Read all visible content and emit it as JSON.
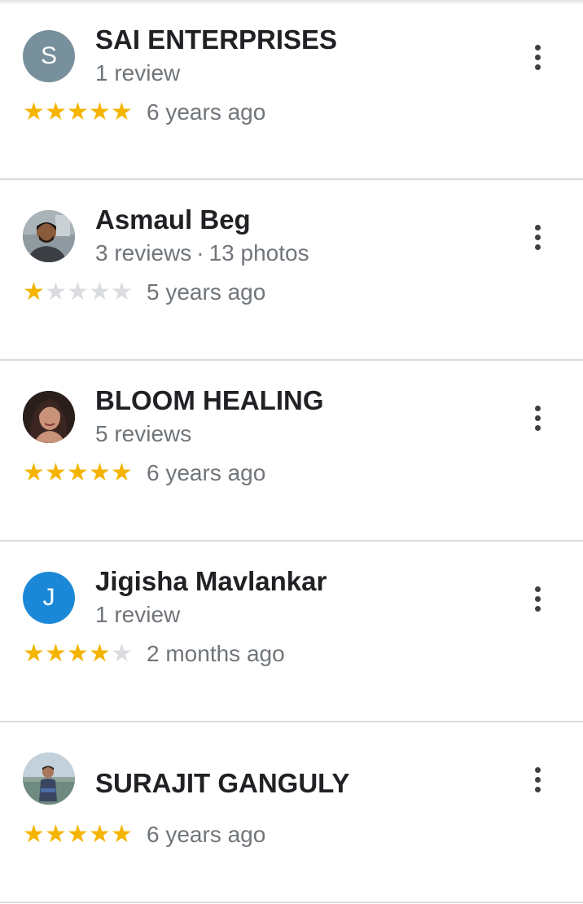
{
  "reviews": [
    {
      "name": "SAI ENTERPRISES",
      "avatar": {
        "type": "letter",
        "letter": "S",
        "color": "#78909c"
      },
      "review_count": "1 review",
      "photo_count": "",
      "rating": 5,
      "date": "6 years ago"
    },
    {
      "name": "Asmaul Beg",
      "avatar": {
        "type": "photo",
        "icon": "user-photo"
      },
      "review_count": "3 reviews",
      "photo_count": "13 photos",
      "rating": 1,
      "date": "5 years ago"
    },
    {
      "name": "BLOOM HEALING",
      "avatar": {
        "type": "photo",
        "icon": "user-photo"
      },
      "review_count": "5 reviews",
      "photo_count": "",
      "rating": 5,
      "date": "6 years ago"
    },
    {
      "name": "Jigisha Mavlankar",
      "avatar": {
        "type": "letter",
        "letter": "J",
        "color": "#1a88d6"
      },
      "review_count": "1 review",
      "photo_count": "",
      "rating": 4,
      "date": "2 months ago"
    },
    {
      "name": "SURAJIT GANGULY",
      "avatar": {
        "type": "photo",
        "icon": "user-photo"
      },
      "review_count": "",
      "photo_count": "",
      "rating": 5,
      "date": "6 years ago"
    }
  ],
  "colors": {
    "star_on": "#f4b400",
    "star_off": "#dadce0",
    "divider": "#dadada"
  }
}
